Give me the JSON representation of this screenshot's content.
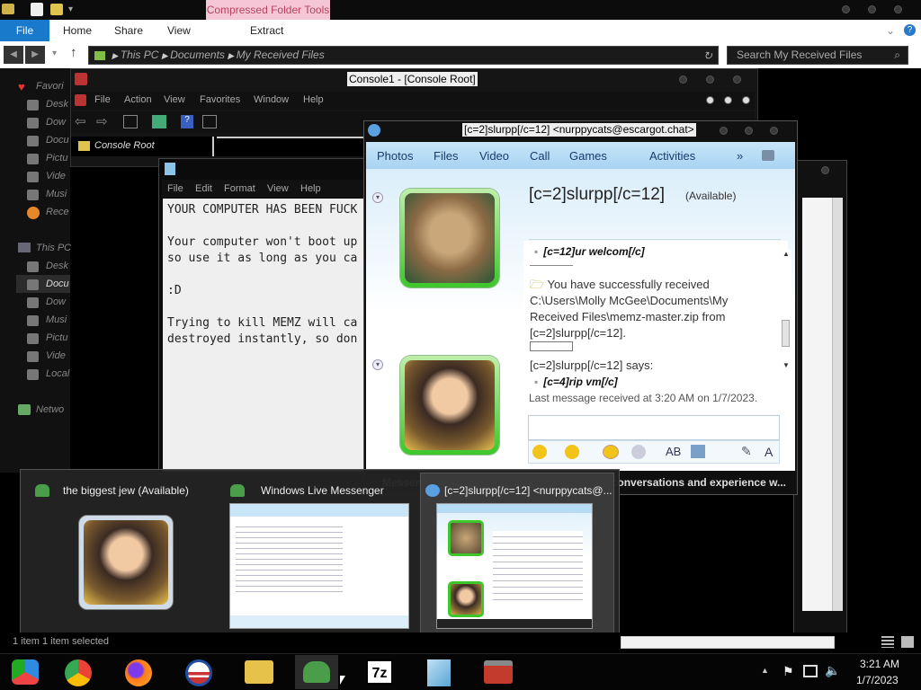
{
  "explorer": {
    "ribbon_tabs": [
      "File",
      "Home",
      "Share",
      "View"
    ],
    "context_header": "Compressed Folder Tools",
    "context_tab": "Extract",
    "breadcrumb": [
      "This PC",
      "Documents",
      "My Received Files"
    ],
    "search_placeholder": "Search My Received Files",
    "nav_items": [
      "Favori",
      "Desk",
      "Dow",
      "Docu",
      "Pictu",
      "Vide",
      "Musi",
      "Rece",
      "This PC",
      "Desk",
      "Docu",
      "Dow",
      "Musi",
      "Pictu",
      "Vide",
      "Local",
      "Netwo"
    ],
    "status_left": "1 item    1 item selected"
  },
  "console": {
    "title": "Console1 - [Console Root]",
    "menu": [
      "File",
      "Action",
      "View",
      "Favorites",
      "Window",
      "Help"
    ],
    "tree_root": "Console Root"
  },
  "notepad": {
    "menu": [
      "File",
      "Edit",
      "Format",
      "View",
      "Help"
    ],
    "text": "YOUR COMPUTER HAS BEEN FUCK\n\nYour computer won't boot up\nso use it as long as you ca\n\n:D\n\nTrying to kill MEMZ will ca\ndestroyed instantly, so don"
  },
  "messenger": {
    "title": "[c=2]slurpp[/c=12] <nurppycats@escargot.chat>",
    "toolbar": [
      "Photos",
      "Files",
      "Video",
      "Call",
      "Games",
      "Activities"
    ],
    "more": "»",
    "contact_name": "[c=2]slurpp[/c=12]",
    "contact_status": "(Available)",
    "messages": {
      "m1": "[c=12]ur welcom[/c]",
      "m2": "You have successfully received C:\\Users\\Molly McGee\\Documents\\My Received Files\\memz-master.zip from [c=2]slurpp[/c=12].",
      "says": "[c=2]slurpp[/c=12] says:",
      "m3": "[c=4]rip vm[/c]",
      "last": "Last message received at 3:20 AM on 1/7/2023."
    },
    "ad": "Messenger Plus! - Spice up your Messenger conversations and experience w..."
  },
  "thumbnails": [
    {
      "title": "the biggest jew (Available)"
    },
    {
      "title": "Windows Live Messenger"
    },
    {
      "title": "[c=2]slurpp[/c=12] <nurppycats@..."
    }
  ],
  "clock": {
    "time": "3:21 AM",
    "date": "1/7/2023"
  }
}
